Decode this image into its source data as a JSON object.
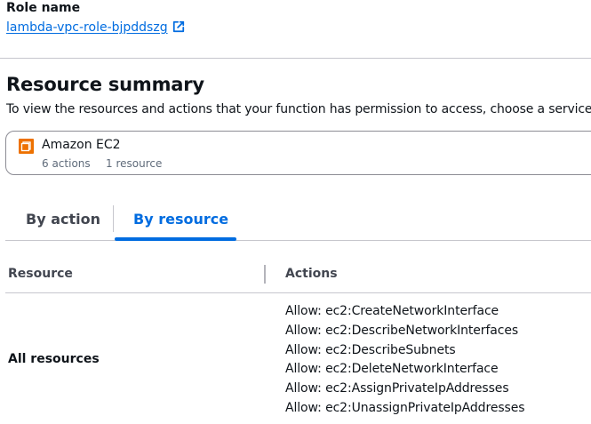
{
  "role": {
    "label": "Role name",
    "name": "lambda-vpc-role-bjpddszg"
  },
  "resource_summary": {
    "title": "Resource summary",
    "description": "To view the resources and actions that your function has permission to access, choose a service."
  },
  "service": {
    "name": "Amazon EC2",
    "actions_count": "6 actions",
    "resources_count": "1 resource",
    "icon_color": "#ed7100"
  },
  "tabs": [
    {
      "label": "By action",
      "selected": false
    },
    {
      "label": "By resource",
      "selected": true
    }
  ],
  "table": {
    "columns": [
      "Resource",
      "Actions"
    ],
    "rows": [
      {
        "resource": "All resources",
        "actions": [
          "Allow: ec2:CreateNetworkInterface",
          "Allow: ec2:DescribeNetworkInterfaces",
          "Allow: ec2:DescribeSubnets",
          "Allow: ec2:DeleteNetworkInterface",
          "Allow: ec2:AssignPrivateIpAddresses",
          "Allow: ec2:UnassignPrivateIpAddresses"
        ]
      }
    ]
  },
  "colors": {
    "link": "#006ce0",
    "text": "#0f141a",
    "muted": "#5f6b7a"
  }
}
